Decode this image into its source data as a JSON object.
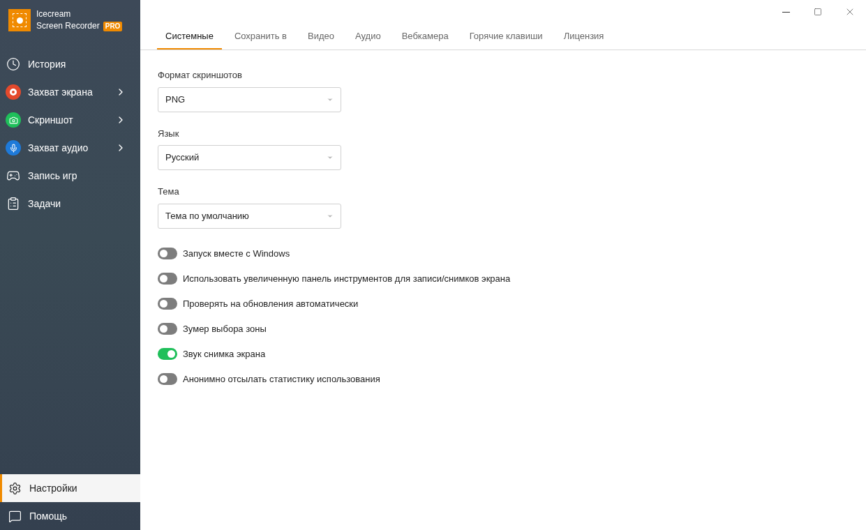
{
  "app": {
    "name_line1": "Icecream",
    "name_line2": "Screen Recorder",
    "badge": "PRO"
  },
  "sidebar": {
    "items": [
      {
        "label": "История",
        "selected": false,
        "submenu": false
      },
      {
        "label": "Захват экрана",
        "selected": false,
        "submenu": true
      },
      {
        "label": "Скриншот",
        "selected": false,
        "submenu": true
      },
      {
        "label": "Захват аудио",
        "selected": false,
        "submenu": true
      },
      {
        "label": "Запись игр",
        "selected": false,
        "submenu": false
      },
      {
        "label": "Задачи",
        "selected": false,
        "submenu": false
      }
    ],
    "bottom_items": [
      {
        "label": "Настройки",
        "selected": true
      },
      {
        "label": "Помощь",
        "selected": false
      }
    ]
  },
  "tabs": [
    {
      "label": "Системные",
      "selected": true
    },
    {
      "label": "Сохранить в",
      "selected": false
    },
    {
      "label": "Видео",
      "selected": false
    },
    {
      "label": "Аудио",
      "selected": false
    },
    {
      "label": "Вебкамера",
      "selected": false
    },
    {
      "label": "Горячие клавиши",
      "selected": false
    },
    {
      "label": "Лицензия",
      "selected": false
    }
  ],
  "selects": [
    {
      "label": "Формат скриншотов",
      "value": "PNG"
    },
    {
      "label": "Язык",
      "value": "Русский"
    },
    {
      "label": "Тема",
      "value": "Тема по умолчанию"
    }
  ],
  "toggles": [
    {
      "label": "Запуск вместе с Windows",
      "on": false
    },
    {
      "label": "Использовать увеличенную панель инструментов для записи/снимков экрана",
      "on": false
    },
    {
      "label": "Проверять на обновления автоматически",
      "on": false
    },
    {
      "label": "Зумер выбора зоны",
      "on": false
    },
    {
      "label": "Звук снимка экрана",
      "on": true
    },
    {
      "label": "Анонимно отсылать статистику использования",
      "on": false
    }
  ]
}
